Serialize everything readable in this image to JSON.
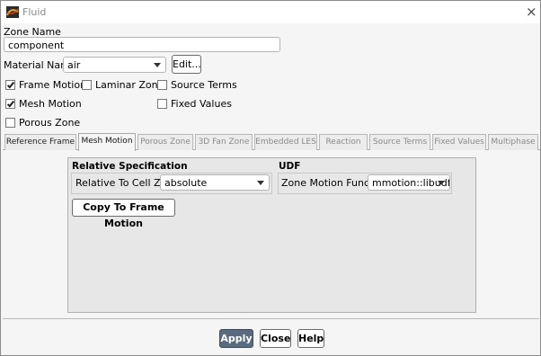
{
  "window": {
    "title": "Fluid",
    "close_glyph": "×"
  },
  "zone_name": {
    "label": "Zone Name",
    "value": "component"
  },
  "material": {
    "label": "Material Name",
    "value": "air",
    "edit_label": "Edit..."
  },
  "options": {
    "frame_motion": {
      "label": "Frame Motion",
      "checked": true
    },
    "laminar_zone": {
      "label": "Laminar Zone",
      "checked": false
    },
    "source_terms": {
      "label": "Source Terms",
      "checked": false
    },
    "mesh_motion": {
      "label": "Mesh Motion",
      "checked": true
    },
    "fixed_values": {
      "label": "Fixed Values",
      "checked": false
    },
    "porous_zone": {
      "label": "Porous Zone",
      "checked": false
    }
  },
  "tabs": [
    {
      "label": "Reference Frame",
      "state": "enabled"
    },
    {
      "label": "Mesh Motion",
      "state": "active"
    },
    {
      "label": "Porous Zone",
      "state": "disabled"
    },
    {
      "label": "3D Fan Zone",
      "state": "disabled"
    },
    {
      "label": "Embedded LES",
      "state": "disabled"
    },
    {
      "label": "Reaction",
      "state": "disabled"
    },
    {
      "label": "Source Terms",
      "state": "disabled"
    },
    {
      "label": "Fixed Values",
      "state": "disabled"
    },
    {
      "label": "Multiphase",
      "state": "disabled"
    }
  ],
  "mesh_motion_panel": {
    "relative_spec": {
      "title": "Relative Specification",
      "cell_zone_label": "Relative To Cell Zone",
      "cell_zone_value": "absolute"
    },
    "udf": {
      "title": "UDF",
      "zone_motion_label": "Zone Motion Function",
      "zone_motion_value": "mmotion::libudf"
    },
    "copy_button": "Copy To Frame Motion"
  },
  "footer": {
    "apply": "Apply",
    "close": "Close",
    "help": "Help"
  },
  "colors": {
    "primary_button": "#5a6b7f",
    "panel_bg": "#e7e7e7",
    "dialog_bg": "#f5f5f5"
  },
  "icons": {
    "app": "fluent-app-icon",
    "close": "close-icon",
    "dropdown": "chevron-down-icon",
    "check": "check-icon"
  }
}
